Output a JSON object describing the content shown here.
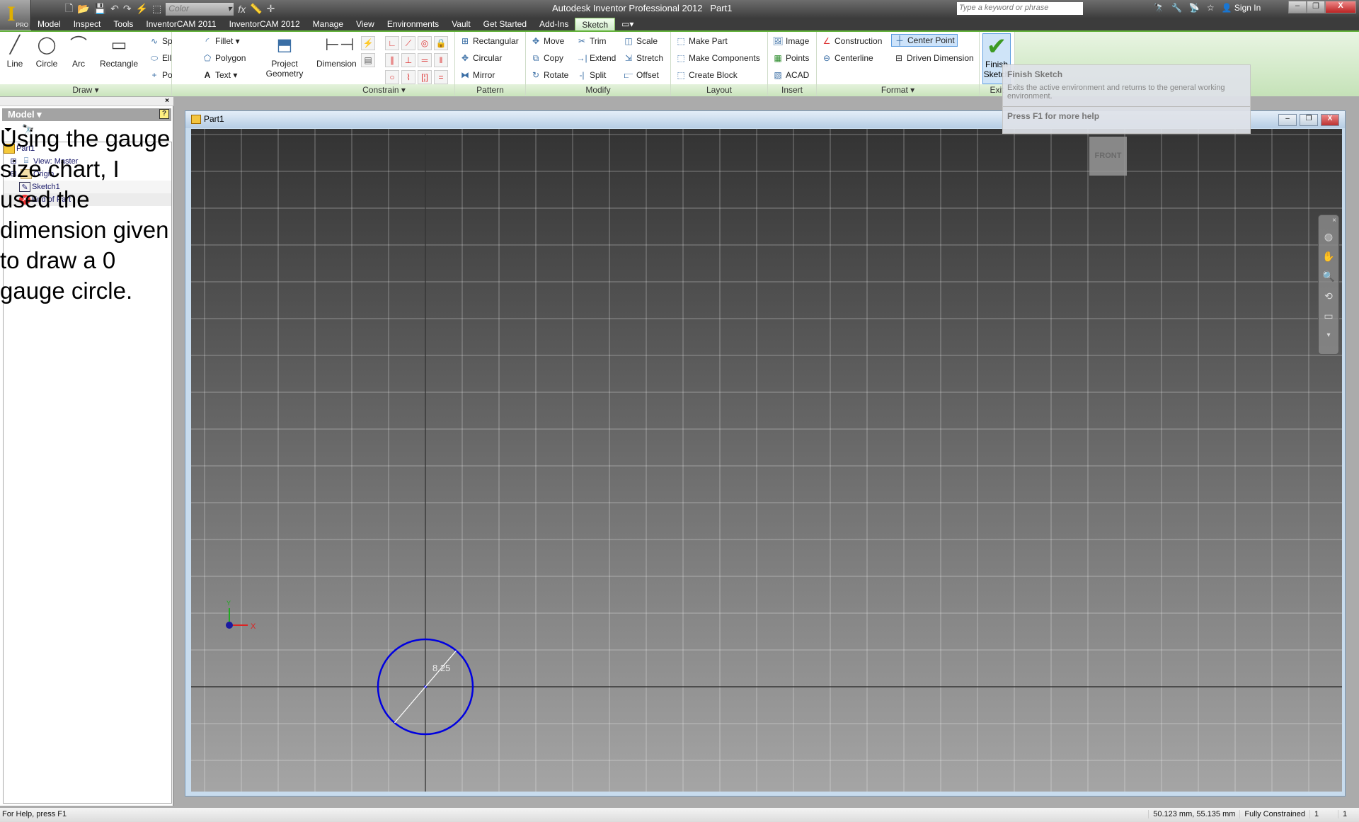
{
  "app": {
    "title": "Autodesk Inventor Professional 2012",
    "document": "Part1",
    "app_button_badge": "PRO"
  },
  "qat": {
    "color_select": "Color",
    "fx_label": "fx"
  },
  "search": {
    "placeholder": "Type a keyword or phrase"
  },
  "signin": {
    "label": "Sign In"
  },
  "tabs": [
    "Model",
    "Inspect",
    "Tools",
    "InventorCAM 2011",
    "InventorCAM 2012",
    "Manage",
    "View",
    "Environments",
    "Vault",
    "Get Started",
    "Add-Ins",
    "Sketch"
  ],
  "active_tab": "Sketch",
  "ribbon": {
    "draw": {
      "label": "Draw",
      "line": "Line",
      "circle": "Circle",
      "arc": "Arc",
      "rectangle": "Rectangle",
      "spline": "Spline",
      "ellipse": "Ellipse",
      "point": "Point",
      "fillet": "Fillet",
      "polygon": "Polygon",
      "text": "Text",
      "project_geometry_1": "Project",
      "project_geometry_2": "Geometry"
    },
    "constrain": {
      "label": "Constrain",
      "dimension": "Dimension"
    },
    "pattern": {
      "label": "Pattern",
      "rectangular": "Rectangular",
      "circular": "Circular",
      "mirror": "Mirror"
    },
    "modify": {
      "label": "Modify",
      "move": "Move",
      "copy": "Copy",
      "rotate": "Rotate",
      "trim": "Trim",
      "extend": "Extend",
      "split": "Split",
      "scale": "Scale",
      "stretch": "Stretch",
      "offset": "Offset"
    },
    "layout": {
      "label": "Layout",
      "make_part": "Make Part",
      "make_components": "Make Components",
      "create_block": "Create Block"
    },
    "insert": {
      "label": "Insert",
      "image": "Image",
      "points": "Points",
      "acad": "ACAD"
    },
    "format": {
      "label": "Format",
      "construction": "Construction",
      "center_point": "Center Point",
      "centerline": "Centerline",
      "driven_dimension": "Driven Dimension"
    },
    "exit": {
      "label": "Exit",
      "finish_1": "Finish",
      "finish_2": "Sketch"
    }
  },
  "tooltip": {
    "title": "Finish Sketch",
    "description": "Exits the active environment and returns to the general working environment.",
    "help": "Press F1 for more help"
  },
  "browser": {
    "header": "Model",
    "tree": [
      {
        "label": "Part1"
      },
      {
        "label": "View: Master"
      },
      {
        "label": "Origin"
      },
      {
        "label": "Sketch1"
      },
      {
        "label": "End of Part"
      }
    ]
  },
  "note": "Using the gauge size chart, I used the dimension given to draw a 0 gauge circle.",
  "viewport": {
    "title": "Part1",
    "viewcube": "FRONT",
    "dimension": "8.25",
    "axis_x": "X",
    "axis_y": "Y",
    "circle_color": "#0000e0"
  },
  "status": {
    "help": "For Help, press F1",
    "coords": "50.123 mm, 55.135 mm",
    "constraint": "Fully Constrained",
    "count1": "1",
    "count2": "1"
  }
}
